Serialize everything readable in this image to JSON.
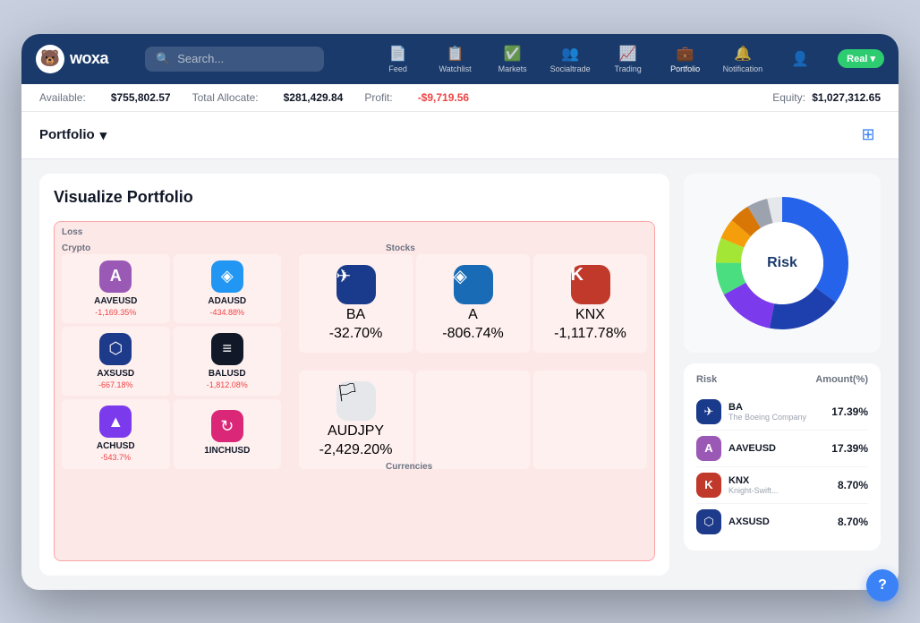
{
  "app": {
    "logo_text": "woxa",
    "logo_icon": "🐻"
  },
  "nav": {
    "search_placeholder": "Search...",
    "items": [
      {
        "id": "feed",
        "label": "Feed",
        "icon": "📄"
      },
      {
        "id": "watchlist",
        "label": "Watchlist",
        "icon": "📋"
      },
      {
        "id": "markets",
        "label": "Markets",
        "icon": "✅"
      },
      {
        "id": "socialtrade",
        "label": "Socialtrade",
        "icon": "👥"
      },
      {
        "id": "trading",
        "label": "Trading",
        "icon": "📊"
      },
      {
        "id": "portfolio",
        "label": "Portfolio",
        "icon": "💼",
        "active": true
      },
      {
        "id": "notification",
        "label": "Notification",
        "icon": "🔔"
      }
    ],
    "account_badge": "Real ▾",
    "account_icon": "👤"
  },
  "account_bar": {
    "available_label": "Available:",
    "available_value": "$755,802.57",
    "allocate_label": "Total Allocate:",
    "allocate_value": "$281,429.84",
    "profit_label": "Profit:",
    "profit_value": "-$9,719.56",
    "equity_label": "Equity:",
    "equity_value": "$1,027,312.65"
  },
  "portfolio": {
    "title": "Portfolio",
    "section_title": "Visualize Portfolio",
    "section_label_loss": "Loss",
    "section_label_crypto": "Crypto",
    "section_label_stocks": "Stocks",
    "section_label_currencies": "Currencies"
  },
  "treemap": {
    "crypto": [
      {
        "id": "aaveusd",
        "name": "AAVEUSD",
        "change": "-1,169.35%",
        "icon": "A",
        "icon_bg": "#9b59b6"
      },
      {
        "id": "adausd",
        "name": "ADAUSD",
        "change": "-434.88%",
        "icon": "◈",
        "icon_bg": "#2196f3"
      },
      {
        "id": "axsusd",
        "name": "AXSUSD",
        "change": "-667.18%",
        "icon": "⬡",
        "icon_bg": "#1e3a8a"
      },
      {
        "id": "balusd",
        "name": "BALUSD",
        "change": "-1,812.08%",
        "icon": "≡",
        "icon_bg": "#111827"
      },
      {
        "id": "achusd",
        "name": "ACHUSD",
        "change": "-543.7%",
        "icon": "▲",
        "icon_bg": "#7c3aed"
      },
      {
        "id": "1inchusd",
        "name": "1INCHUSD",
        "change": "",
        "icon": "↻",
        "icon_bg": "#db2777"
      }
    ],
    "stocks": [
      {
        "id": "ba",
        "name": "BA",
        "change": "-32.70%",
        "icon": "✈",
        "icon_bg": "#1a3a8b"
      },
      {
        "id": "a",
        "name": "A",
        "change": "-806.74%",
        "icon": "◈",
        "icon_bg": "#1a6bb5"
      },
      {
        "id": "knx",
        "name": "KNX",
        "change": "-1,117.78%",
        "icon": "K",
        "icon_bg": "#c0392b"
      }
    ],
    "currencies": [
      {
        "id": "audjpy",
        "name": "AUDJPY",
        "change": "-2,429.20%",
        "icon": "🏳",
        "icon_bg": "#e5e7eb"
      }
    ]
  },
  "donut_chart": {
    "label": "Risk",
    "segments": [
      {
        "color": "#2563eb",
        "pct": 35
      },
      {
        "color": "#1e40af",
        "pct": 18
      },
      {
        "color": "#7c3aed",
        "pct": 14
      },
      {
        "color": "#4ade80",
        "pct": 8
      },
      {
        "color": "#a3e635",
        "pct": 6
      },
      {
        "color": "#fbbf24",
        "pct": 5
      },
      {
        "color": "#d97706",
        "pct": 5
      },
      {
        "color": "#9ca3af",
        "pct": 5
      },
      {
        "color": "#6b7280",
        "pct": 4
      }
    ]
  },
  "risk_table": {
    "col1": "Risk",
    "col2": "Amount(%)",
    "rows": [
      {
        "id": "ba",
        "name": "BA",
        "sub": "The Boeing Company",
        "pct": "17.39%",
        "icon": "✈",
        "icon_bg": "#1a3a8b"
      },
      {
        "id": "aaveusd",
        "name": "AAVEUSD",
        "sub": "",
        "pct": "17.39%",
        "icon": "A",
        "icon_bg": "#9b59b6"
      },
      {
        "id": "knx",
        "name": "KNX",
        "sub": "Knight-Swift...",
        "pct": "8.70%",
        "icon": "K",
        "icon_bg": "#c0392b"
      },
      {
        "id": "axsusd",
        "name": "AXSUSD",
        "sub": "",
        "pct": "8.70%",
        "icon": "⬡",
        "icon_bg": "#1e3a8a"
      }
    ]
  },
  "help_btn": "?"
}
